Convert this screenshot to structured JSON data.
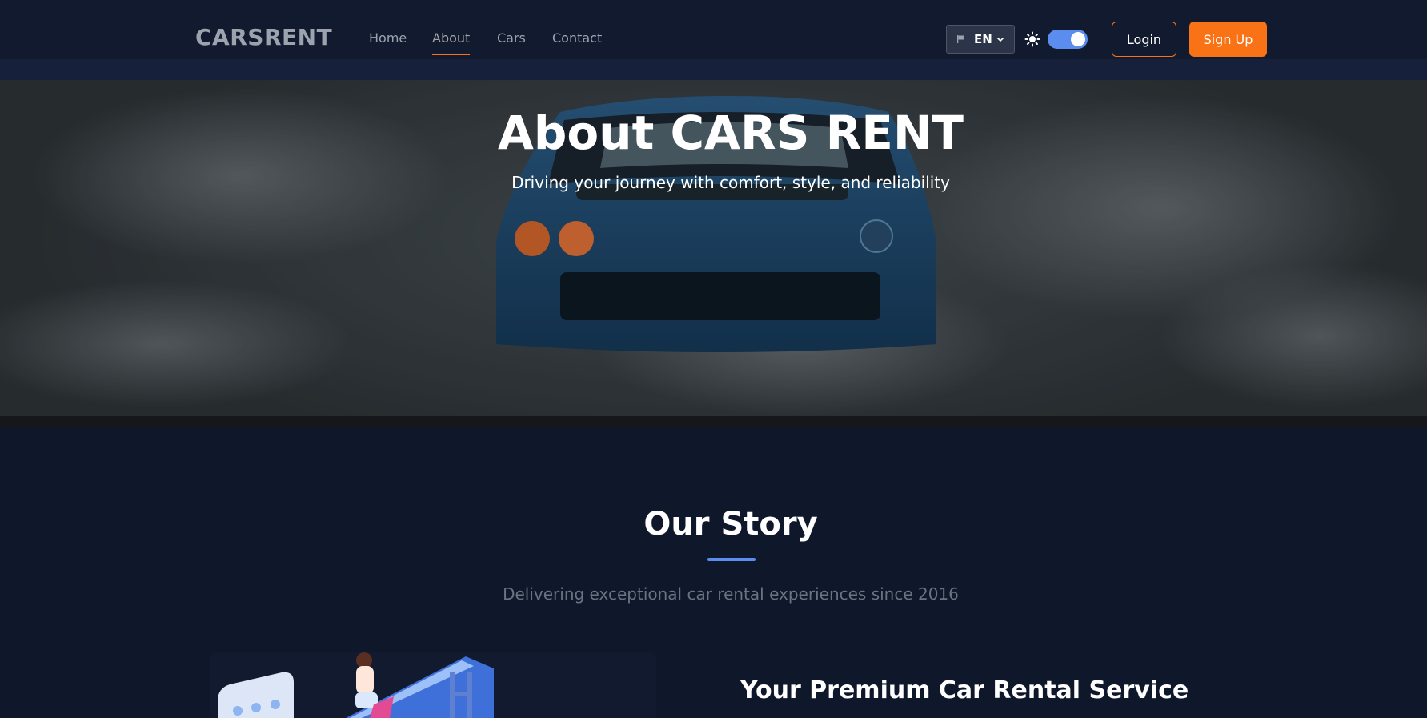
{
  "brand": {
    "logo": "CARSRENT"
  },
  "nav": {
    "links": [
      "Home",
      "About",
      "Cars",
      "Contact"
    ],
    "active": "About"
  },
  "header_controls": {
    "language": "EN",
    "theme_toggle": "on",
    "login_label": "Login",
    "signup_label": "Sign Up"
  },
  "hero": {
    "title": "About CARS RENT",
    "subtitle": "Driving your journey with comfort, style, and reliability"
  },
  "story": {
    "title": "Our Story",
    "subtitle": "Delivering exceptional car rental experiences since 2016",
    "feature_title": "Your Premium Car Rental Service"
  },
  "colors": {
    "accent": "#f97316",
    "toggle": "#5b8def",
    "background": "#0f172a",
    "navbar": "#111a2e"
  },
  "icons": [
    "flag-icon",
    "chevron-down-icon",
    "sun-icon"
  ]
}
